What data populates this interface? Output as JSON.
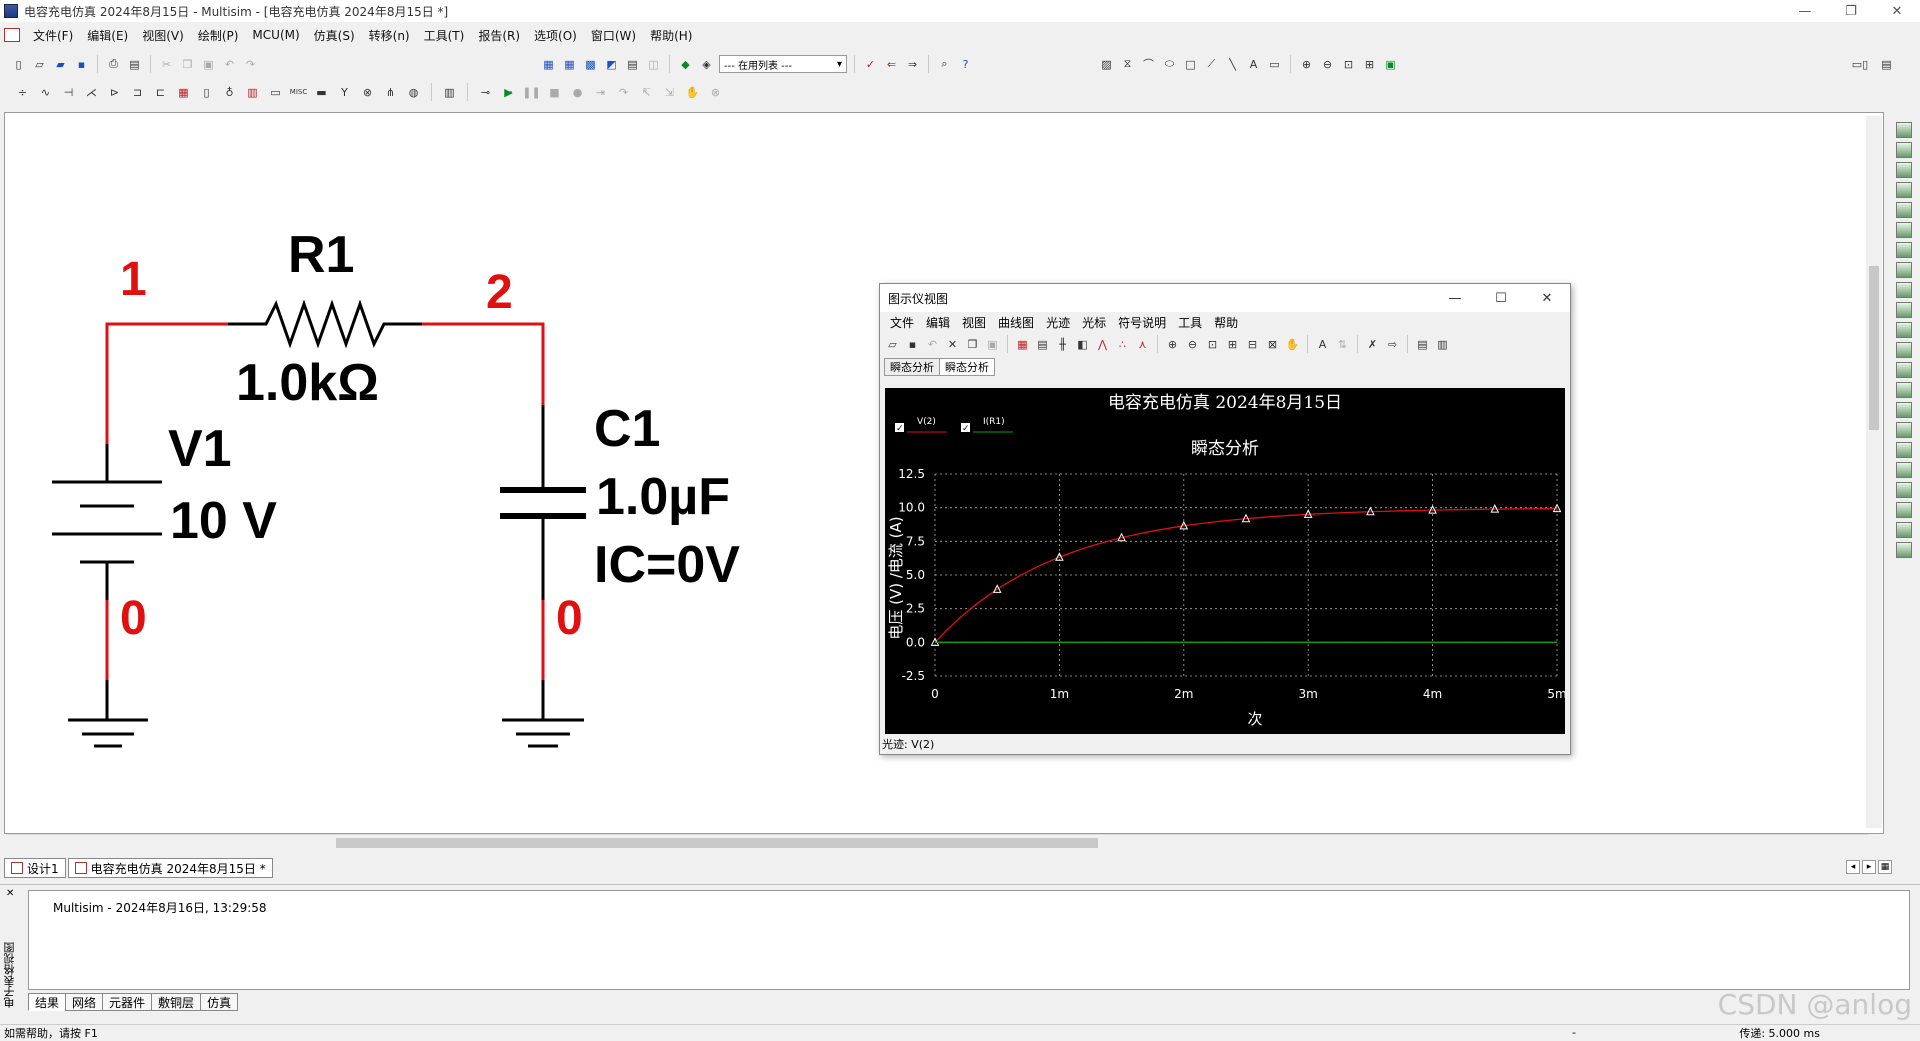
{
  "window": {
    "title": "电容充电仿真 2024年8月15日 - Multisim - [电容充电仿真 2024年8月15日 *]",
    "minimize": "—",
    "restore": "❐",
    "close": "✕"
  },
  "menu": [
    "文件(F)",
    "编辑(E)",
    "视图(V)",
    "绘制(P)",
    "MCU(M)",
    "仿真(S)",
    "转移(n)",
    "工具(T)",
    "报告(R)",
    "选项(O)",
    "窗口(W)",
    "帮助(H)"
  ],
  "toolbar": {
    "in_use_list": "--- 在用列表 ---",
    "help_icon": "?"
  },
  "circuit": {
    "node1": "1",
    "node2": "2",
    "node0_left": "0",
    "node0_right": "0",
    "r_label": "R1",
    "r_value": "1.0kΩ",
    "v_label": "V1",
    "v_value": "10 V",
    "c_label": "C1",
    "c_value": "1.0µF",
    "c_ic": "IC=0V",
    "wire_color": "#e01010",
    "part_color": "#000000"
  },
  "grapher": {
    "title": "图示仪视图",
    "menu": [
      "文件",
      "编辑",
      "视图",
      "曲线图",
      "光迹",
      "光标",
      "符号说明",
      "工具",
      "帮助"
    ],
    "tabs": [
      "瞬态分析",
      "瞬态分析"
    ],
    "status": "光迹: V(2)"
  },
  "chart_data": {
    "type": "line",
    "title": "电容充电仿真 2024年8月15日",
    "subtitle": "瞬态分析",
    "xlabel": "次",
    "ylabel": "电压 (V) /电流 (A)",
    "x_ticks": [
      "0",
      "1m",
      "2m",
      "3m",
      "4m",
      "5m"
    ],
    "y_ticks": [
      "12.5",
      "10.0",
      "7.5",
      "5.0",
      "2.5",
      "0.0",
      "-2.5"
    ],
    "xlim": [
      0,
      0.005
    ],
    "ylim": [
      -2.5,
      12.5
    ],
    "grid": true,
    "legend_position": "top-left",
    "series": [
      {
        "name": "V(2)",
        "color": "#e01010",
        "x": [
          0,
          0.0005,
          0.001,
          0.0015,
          0.002,
          0.0025,
          0.003,
          0.0035,
          0.004,
          0.0045,
          0.005
        ],
        "values": [
          0.0,
          3.93,
          6.32,
          7.77,
          8.65,
          9.18,
          9.5,
          9.7,
          9.82,
          9.89,
          9.93
        ]
      },
      {
        "name": "I(R1)",
        "color": "#10a010",
        "x": [
          0,
          0.005
        ],
        "values": [
          0.0,
          0.0
        ]
      }
    ]
  },
  "bottom": {
    "sheet_tabs": [
      "设计1",
      "电容充电仿真 2024年8月15日 *"
    ],
    "side_label": "电子表格视图",
    "log": "Multisim  -  2024年8月16日, 13:29:58",
    "tabs": [
      "结果",
      "网络",
      "元器件",
      "敷铜层",
      "仿真"
    ],
    "status_help": "如需帮助，请按 F1",
    "status_dash": "-",
    "status_transfer": "传递: 5.000 ms",
    "watermark": "CSDN @anlog"
  }
}
